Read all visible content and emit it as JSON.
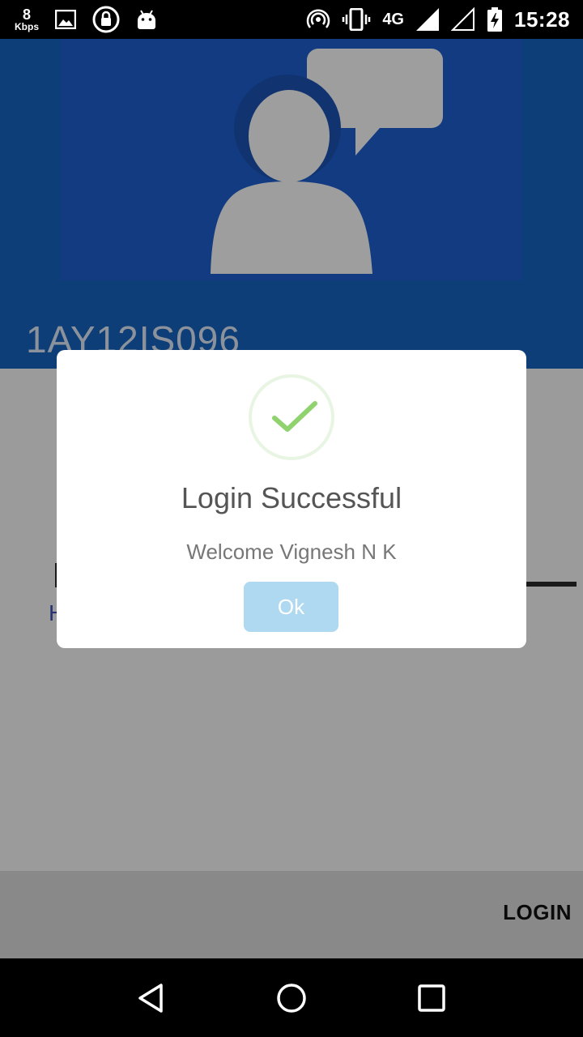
{
  "statusbar": {
    "speed_value": "8",
    "speed_unit": "Kbps",
    "network": "4G",
    "time": "15:28",
    "icons": [
      "image-icon",
      "lock-icon",
      "android-icon",
      "hotspot-icon",
      "vibrate-icon",
      "signal-icon",
      "signal-empty-icon",
      "battery-charging-icon"
    ]
  },
  "header": {
    "user_id": "1AY12IS096",
    "avatar_icon": "user-chat-avatar-icon"
  },
  "body": {
    "link_initial": "H"
  },
  "bottom": {
    "login_label": "LOGIN"
  },
  "dialog": {
    "icon": "check-icon",
    "title": "Login Successful",
    "message": "Welcome Vignesh N K",
    "ok_label": "Ok"
  },
  "navbar": {
    "icons": [
      "back-icon",
      "home-icon",
      "recents-icon"
    ]
  },
  "colors": {
    "header_bg": "#1565c0",
    "avatar_bg": "#1e5fd0",
    "check_green": "#8fd26e",
    "ok_button_bg": "#aed9f0",
    "overlay": "rgba(0,0,0,0.38)"
  }
}
